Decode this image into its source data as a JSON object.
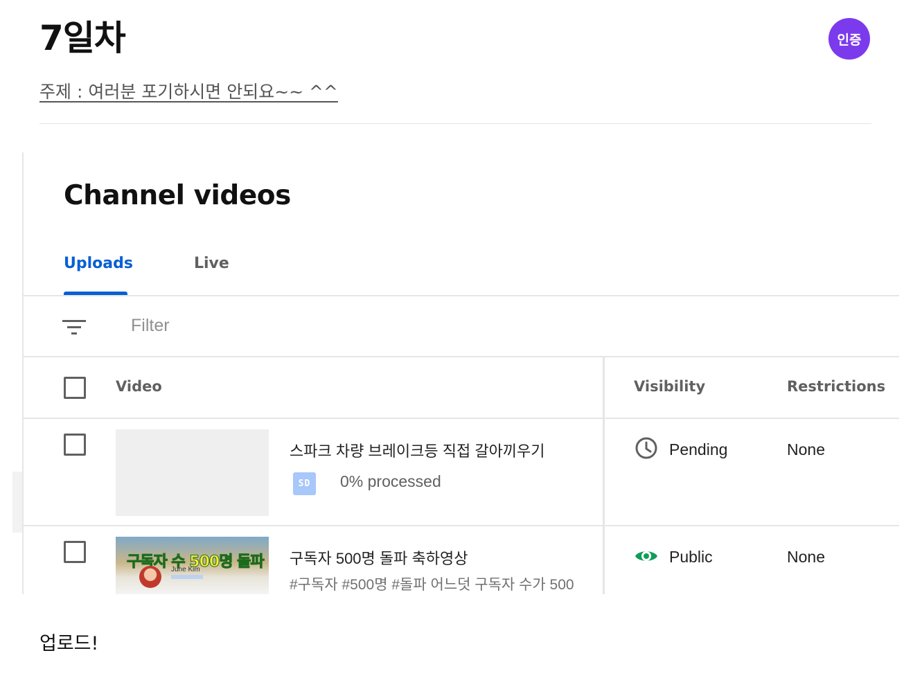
{
  "post": {
    "title": "7일차",
    "badge": "인증",
    "topic": "주제 : 여러분 포기하시면 안되요~~ ^^",
    "footer": "업로드!"
  },
  "screenshot": {
    "heading": "Channel videos",
    "tabs": [
      {
        "label": "Uploads",
        "active": true
      },
      {
        "label": "Live",
        "active": false
      }
    ],
    "filter": {
      "placeholder": "Filter",
      "icon": "filter-icon"
    },
    "columns": {
      "video": "Video",
      "visibility": "Visibility",
      "restrictions": "Restrictions"
    },
    "rows": [
      {
        "title": "스파크 차량 브레이크등 직접 갈아끼우기",
        "quality_badge": "SD",
        "processing": "0% processed",
        "visibility": "Pending",
        "visibility_icon": "clock-icon",
        "restrictions": "None"
      },
      {
        "title": "구독자 500명 돌파 축하영상",
        "description": "#구독자 #500명 #돌파 어느덧 구독자 수가 500",
        "thumbnail_text": "구독자 수 500명 돌파",
        "thumbnail_name": "June Kim",
        "visibility": "Public",
        "visibility_icon": "eye-icon",
        "restrictions": "None"
      }
    ]
  },
  "colors": {
    "accent": "#065fd4",
    "badge": "#7c3aed",
    "public_green": "#0f9d58",
    "pending_gray": "#606060"
  }
}
